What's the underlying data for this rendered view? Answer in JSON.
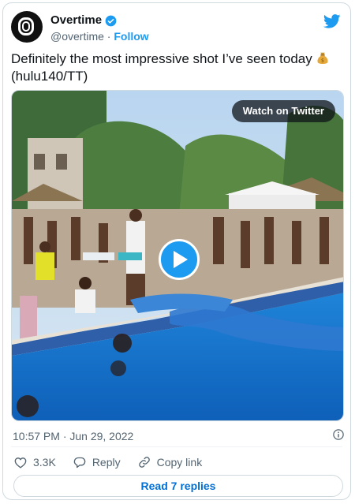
{
  "account": {
    "name": "Overtime",
    "handle": "@overtime",
    "separator": "·",
    "follow_label": "Follow"
  },
  "tweet": {
    "text": "Definitely the most impressive shot I’ve seen today",
    "credit": "(hulu140/TT)",
    "emoji_icon": "money-bag-icon"
  },
  "media": {
    "watch_label": "Watch on Twitter"
  },
  "meta": {
    "timestamp": "10:57 PM · Jun 29, 2022"
  },
  "actions": {
    "likes": "3.3K",
    "reply_label": "Reply",
    "copy_label": "Copy link"
  },
  "footer": {
    "read_replies_label": "Read 7 replies"
  },
  "colors": {
    "accent": "#1d9bf0",
    "text": "#0f1419",
    "muted": "#536471",
    "border": "#cfd9de"
  }
}
